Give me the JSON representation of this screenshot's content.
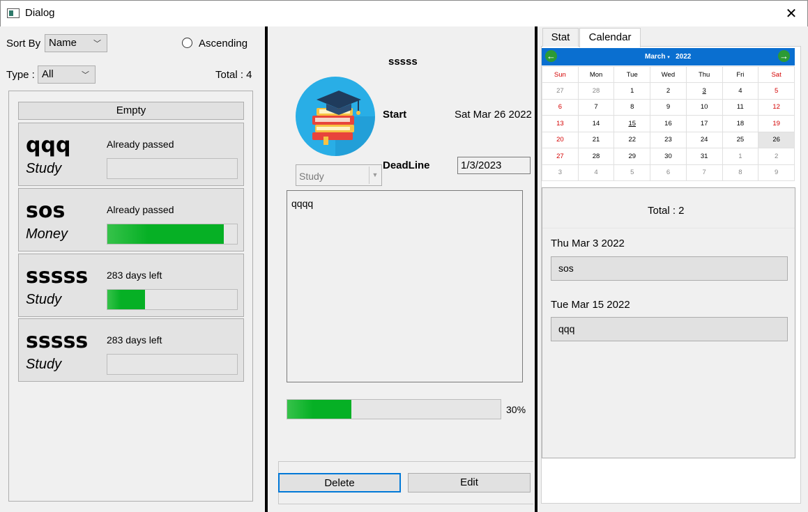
{
  "window": {
    "title": "Dialog",
    "close_glyph": "✕"
  },
  "filters": {
    "sort_by_label": "Sort By",
    "sort_by_value": "Name",
    "ascending_label": "Ascending",
    "type_label": "Type :",
    "type_value": "All",
    "total": "Total : 4"
  },
  "list": {
    "empty_button": "Empty",
    "items": [
      {
        "name": "qqq",
        "type": "Study",
        "status": "Already passed",
        "progress": 0
      },
      {
        "name": "sos",
        "type": "Money",
        "status": "Already passed",
        "progress": 0.9
      },
      {
        "name": "sssss",
        "type": "Study",
        "status": "283 days left",
        "progress": 0.29
      },
      {
        "name": "sssss",
        "type": "Study",
        "status": "283 days left",
        "progress": 0
      }
    ]
  },
  "detail": {
    "title": "sssss",
    "start_label": "Start",
    "start_value": "Sat Mar 26 2022",
    "deadline_label": "DeadLine",
    "deadline_value": "1/3/2023",
    "type_value": "Study",
    "notes": "qqqq",
    "progress": 0.3,
    "progress_text": "30%",
    "delete_button": "Delete",
    "edit_button": "Edit",
    "logo_icon": "books-graduation-cap-icon"
  },
  "tabs": [
    {
      "label": "Stat"
    },
    {
      "label": "Calendar"
    }
  ],
  "calendar": {
    "month": "March",
    "year": "2022",
    "prev_icon": "←",
    "next_icon": "→",
    "weekdays": [
      "Sun",
      "Mon",
      "Tue",
      "Wed",
      "Thu",
      "Fri",
      "Sat"
    ],
    "weeks": [
      [
        "27",
        "28",
        "1",
        "2",
        "3",
        "4",
        "5"
      ],
      [
        "6",
        "7",
        "8",
        "9",
        "10",
        "11",
        "12"
      ],
      [
        "13",
        "14",
        "15",
        "16",
        "17",
        "18",
        "19"
      ],
      [
        "20",
        "21",
        "22",
        "23",
        "24",
        "25",
        "26"
      ],
      [
        "27",
        "28",
        "29",
        "30",
        "31",
        "1",
        "2"
      ],
      [
        "3",
        "4",
        "5",
        "6",
        "7",
        "8",
        "9"
      ]
    ]
  },
  "events": {
    "total": "Total : 2",
    "items": [
      {
        "date": "Thu Mar 3 2022",
        "name": "sos"
      },
      {
        "date": "Tue Mar 15 2022",
        "name": "qqq"
      }
    ]
  }
}
